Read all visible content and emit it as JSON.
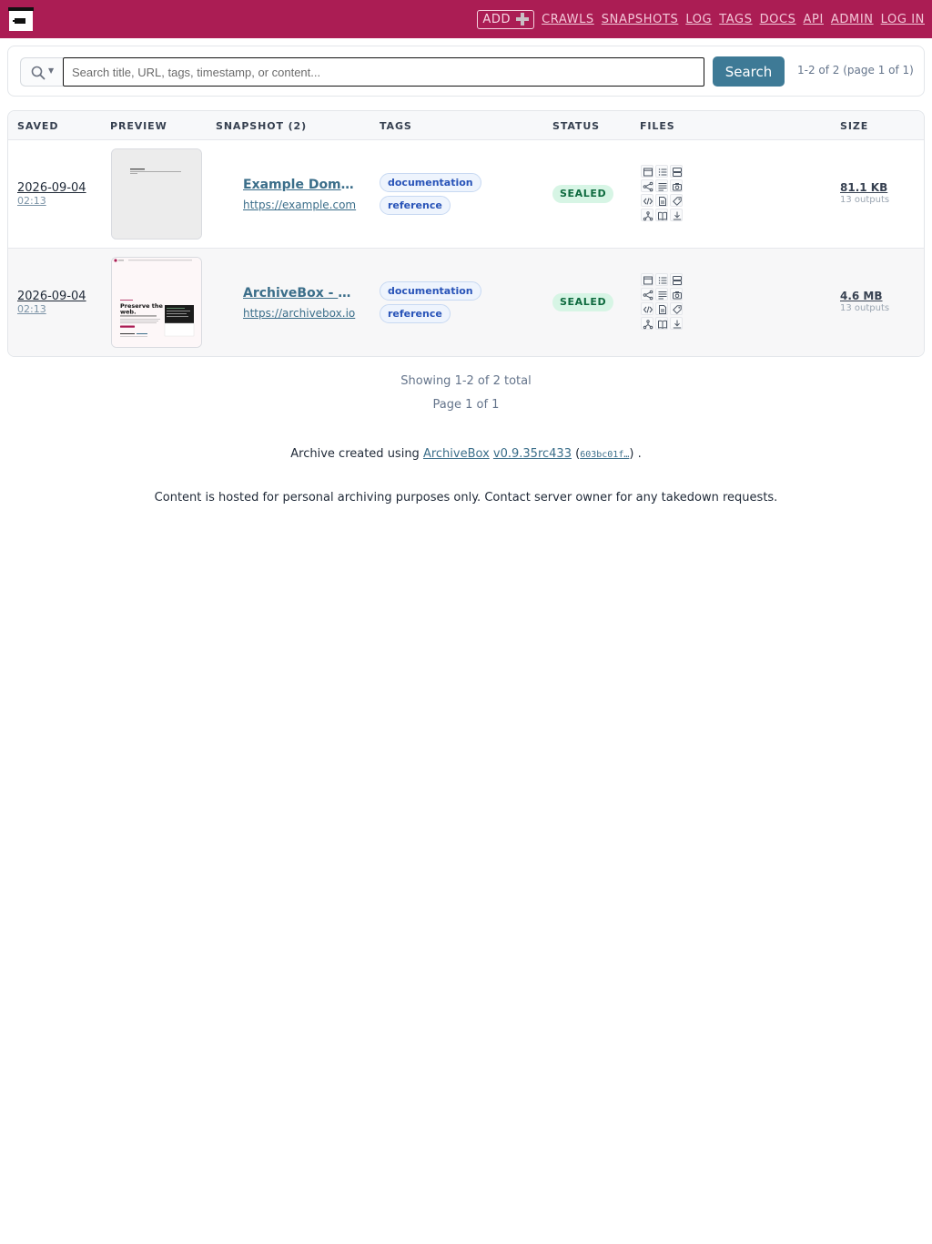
{
  "nav": {
    "add_label": "ADD",
    "items": [
      "CRAWLS",
      "SNAPSHOTS",
      "LOG",
      "TAGS",
      "DOCS",
      "API",
      "ADMIN",
      "LOG IN"
    ]
  },
  "search": {
    "placeholder": "Search title, URL, tags, timestamp, or content...",
    "button_label": "Search",
    "summary": "1-2 of 2 (page 1 of 1)"
  },
  "table": {
    "headers": [
      "SAVED",
      "PREVIEW",
      "SNAPSHOT (2)",
      "TAGS",
      "STATUS",
      "FILES",
      "SIZE"
    ],
    "rows": [
      {
        "date": "2026-09-04",
        "time": "02:13",
        "title": "Example Domain",
        "url": "https://example.com",
        "tags": [
          "documentation",
          "reference"
        ],
        "status": "SEALED",
        "size": "81.1 KB",
        "outputs": "13 outputs"
      },
      {
        "date": "2026-09-04",
        "time": "02:13",
        "title": "ArchiveBox - Open-source self-hosted web archiving",
        "url": "https://archivebox.io",
        "tags": [
          "documentation",
          "reference"
        ],
        "status": "SEALED",
        "size": "4.6 MB",
        "outputs": "13 outputs",
        "preview": {
          "headline_1": "Preserve the",
          "headline_2": "web."
        }
      }
    ]
  },
  "footer": {
    "showing": "Showing 1-2 of 2 total",
    "page": "Page 1 of 1",
    "credit_prefix": "Archive created using",
    "credit_link": "ArchiveBox",
    "credit_version": "v0.9.35rc433",
    "credit_commit": "603bc01f…",
    "credit_open": "(",
    "credit_close": ") .",
    "notice": "Content is hosted for personal archiving purposes only. Contact server owner for any takedown requests."
  },
  "colors": {
    "header_bg": "#ab1d54",
    "search_button": "#3e7a96",
    "link": "#3b6e8a",
    "tag_text": "#2853b8",
    "status_bg": "#d7f5e5",
    "status_text": "#0f6b3f"
  },
  "file_icons": [
    "browser-icon",
    "list-icon",
    "server-icon",
    "share-icon",
    "text-lines-icon",
    "camera-icon",
    "code-icon",
    "pdf-icon",
    "tag-icon",
    "git-icon",
    "book-icon",
    "download-icon"
  ]
}
